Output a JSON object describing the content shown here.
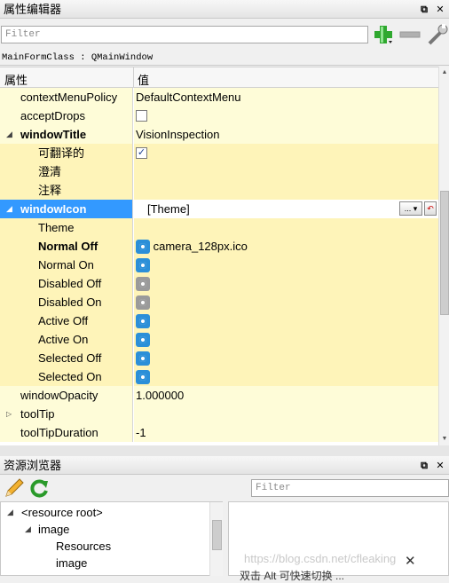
{
  "property_editor": {
    "title": "属性编辑器",
    "filter_placeholder": "Filter",
    "class_line": "MainFormClass : QMainWindow",
    "col_property": "属性",
    "col_value": "值",
    "rows": [
      {
        "name": "contextMenuPolicy",
        "value": "DefaultContextMenu"
      },
      {
        "name": "acceptDrops",
        "value": ""
      },
      {
        "name": "windowTitle",
        "value": "VisionInspection"
      },
      {
        "name": "可翻译的",
        "value": ""
      },
      {
        "name": "澄清",
        "value": ""
      },
      {
        "name": "注释",
        "value": ""
      },
      {
        "name": "windowIcon",
        "value": "[Theme]"
      },
      {
        "name": "Theme",
        "value": ""
      },
      {
        "name": "Normal Off",
        "value": "camera_128px.ico"
      },
      {
        "name": "Normal On",
        "value": ""
      },
      {
        "name": "Disabled Off",
        "value": ""
      },
      {
        "name": "Disabled On",
        "value": ""
      },
      {
        "name": "Active Off",
        "value": ""
      },
      {
        "name": "Active On",
        "value": ""
      },
      {
        "name": "Selected Off",
        "value": ""
      },
      {
        "name": "Selected On",
        "value": ""
      },
      {
        "name": "windowOpacity",
        "value": "1.000000"
      },
      {
        "name": "toolTip",
        "value": ""
      },
      {
        "name": "toolTipDuration",
        "value": "-1"
      }
    ],
    "theme_button": "...",
    "translatable_checked": true,
    "accept_drops_checked": false
  },
  "resource_browser": {
    "title": "资源浏览器",
    "filter_placeholder": "Filter",
    "tree": [
      {
        "label": "<resource root>"
      },
      {
        "label": "image"
      },
      {
        "label": "Resources"
      },
      {
        "label": "image"
      }
    ],
    "watermark": "https://blog.csdn.net/cfleaking",
    "bottom_text": "双击 Alt 可快速切换 ..."
  },
  "colors": {
    "highlight": "#3399ff",
    "row_yellow": "#fefcd8",
    "row_sub": "#fef4b9",
    "radio_blue": "#2b8fd8"
  }
}
